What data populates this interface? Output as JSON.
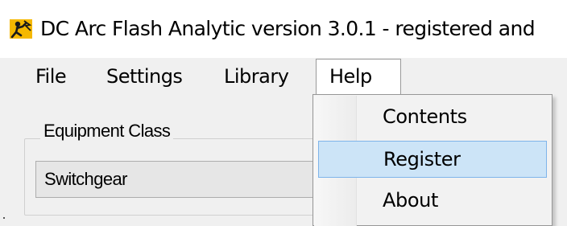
{
  "window": {
    "title": "DC Arc Flash Analytic version 3.0.1 - registered and",
    "icon": "arc-flash-app-icon"
  },
  "menubar": {
    "items": [
      {
        "label": "File"
      },
      {
        "label": "Settings"
      },
      {
        "label": "Library"
      },
      {
        "label": "Help",
        "state": "open"
      }
    ]
  },
  "help_menu": {
    "items": [
      {
        "label": "Contents",
        "highlighted": false
      },
      {
        "label": "Register",
        "highlighted": true
      },
      {
        "label": "About",
        "highlighted": false
      }
    ],
    "highlight_color": "#cce4f7",
    "highlight_border": "#7eb4ea"
  },
  "equipment_class": {
    "group_label": "Equipment Class",
    "selected_value": "Switchgear"
  },
  "colors": {
    "client_background": "#f0f0f0",
    "icon_accent": "#f5b800"
  }
}
